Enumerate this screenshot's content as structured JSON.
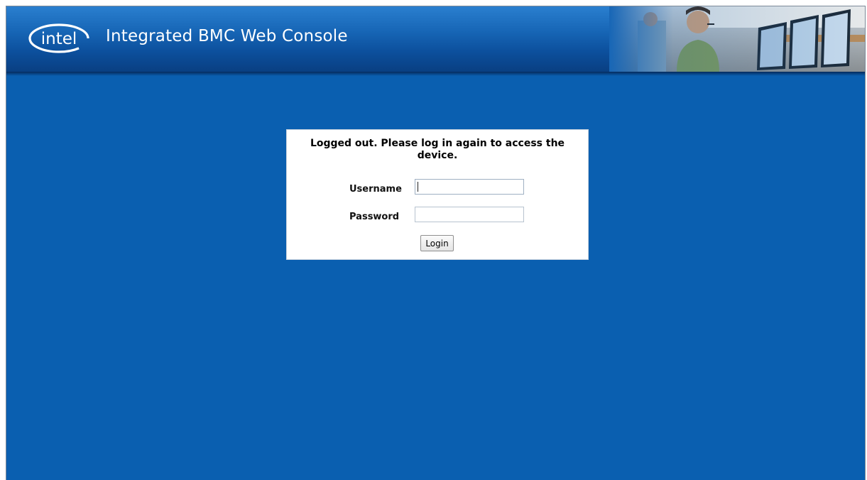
{
  "header": {
    "logo_text": "intel",
    "title": "Integrated BMC Web Console",
    "photo": "operator-at-workstation-photo"
  },
  "login": {
    "message": "Logged out. Please log in again to access the device.",
    "username_label": "Username",
    "username_value": "",
    "password_label": "Password",
    "password_value": "",
    "login_button_label": "Login"
  },
  "colors": {
    "page_background": "#0a5fb0",
    "header_top": "#2a7fcf",
    "header_bottom": "#093f82",
    "login_panel": "#ffffff"
  }
}
